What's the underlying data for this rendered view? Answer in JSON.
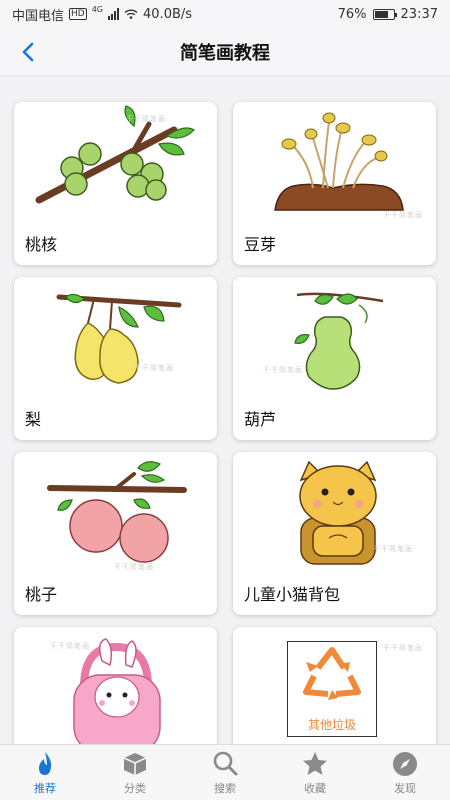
{
  "status": {
    "carrier": "中国电信",
    "hd": "HD",
    "net": "4G",
    "speed": "40.0B/s",
    "battery": "76%",
    "battery_level": 0.76,
    "time": "23:37"
  },
  "header": {
    "title": "简笔画教程",
    "back_icon": "chevron-left-icon"
  },
  "watermark": "千千简笔画",
  "cards": [
    {
      "label": "桃核"
    },
    {
      "label": "豆芽"
    },
    {
      "label": "梨"
    },
    {
      "label": "葫芦"
    },
    {
      "label": "桃子"
    },
    {
      "label": "儿童小猫背包"
    },
    {
      "label": ""
    },
    {
      "label": "其他垃圾"
    }
  ],
  "tabs": [
    {
      "label": "推荐",
      "icon": "flame-icon",
      "active": true
    },
    {
      "label": "分类",
      "icon": "cube-icon",
      "active": false
    },
    {
      "label": "搜索",
      "icon": "search-icon",
      "active": false
    },
    {
      "label": "收藏",
      "icon": "star-icon",
      "active": false
    },
    {
      "label": "发现",
      "icon": "compass-icon",
      "active": false
    }
  ],
  "colors": {
    "accent": "#1976d2",
    "tab_inactive": "#888888"
  }
}
